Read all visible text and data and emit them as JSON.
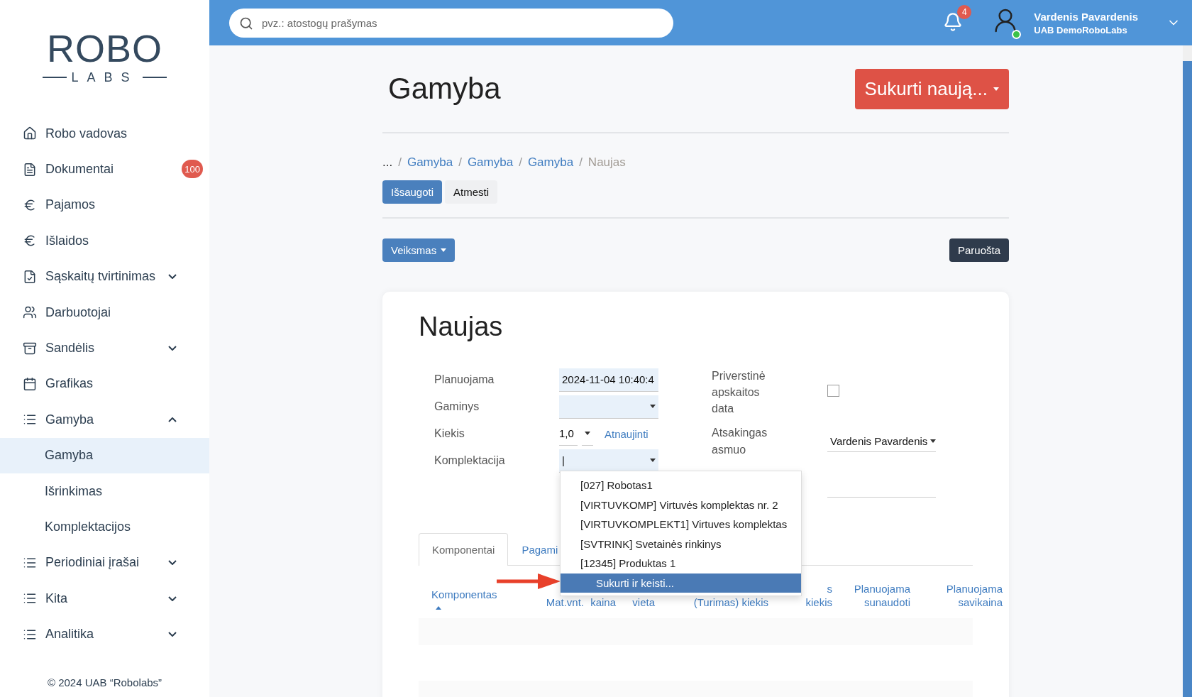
{
  "logo": {
    "top": "ROBO",
    "bottom": "LABS"
  },
  "sidebar": {
    "items": [
      {
        "label": "Robo vadovas",
        "selected": false
      },
      {
        "label": "Dokumentai",
        "badge": "100",
        "selected": false
      },
      {
        "label": "Pajamos",
        "selected": false
      },
      {
        "label": "Išlaidos",
        "selected": false
      },
      {
        "label": "Sąskaitų tvirtinimas",
        "expanded": false,
        "selected": false
      },
      {
        "label": "Darbuotojai",
        "selected": false
      },
      {
        "label": "Sandėlis",
        "expanded": false,
        "selected": false
      },
      {
        "label": "Grafikas",
        "selected": false
      },
      {
        "label": "Gamyba",
        "expanded": true,
        "selected": false,
        "children": [
          {
            "label": "Gamyba",
            "selected": true
          },
          {
            "label": "Išrinkimas",
            "selected": false
          },
          {
            "label": "Komplektacijos",
            "selected": false
          }
        ]
      },
      {
        "label": "Periodiniai įrašai",
        "expanded": false,
        "selected": false
      },
      {
        "label": "Kita",
        "expanded": false,
        "selected": false
      },
      {
        "label": "Analitika",
        "expanded": false,
        "selected": false
      }
    ],
    "footer": "© 2024 UAB “Robolabs”"
  },
  "topbar": {
    "search": {
      "placeholder": "pvz.: atostogų prašymas"
    },
    "notifications": "4",
    "user": {
      "name": "Vardenis Pavardenis",
      "company": "UAB DemoRoboLabs",
      "online": true
    }
  },
  "page": {
    "title": "Gamyba",
    "create_button": "Sukurti naują...",
    "breadcrumb": [
      {
        "label": "...",
        "link": false
      },
      {
        "separator": "/",
        "label": "Gamyba",
        "link": true
      },
      {
        "separator": "/",
        "label": "Gamyba",
        "link": true
      },
      {
        "separator": "/",
        "label": "Gamyba",
        "link": true
      },
      {
        "separator": "/",
        "label": "Naujas",
        "link": false
      }
    ],
    "save_button": "Išsaugoti",
    "discard_button": "Atmesti",
    "action_button": "Veiksmas",
    "status_button": "Paruošta"
  },
  "form": {
    "title": "Naujas",
    "left_fields": [
      {
        "label": "Planuojama",
        "kind": "text",
        "value": "2024-11-04 10:40:4"
      },
      {
        "label": "Gaminys",
        "kind": "select"
      },
      {
        "label": "Kiekis",
        "kind": "quantity",
        "value": "1,0",
        "link": "Atnaujinti"
      },
      {
        "label": "Komplektacija",
        "kind": "select",
        "value": "|"
      }
    ],
    "right_fields": [
      {
        "label": "Priverstinė apskaitos data",
        "kind": "checkbox",
        "checked": false
      },
      {
        "label": "Atsakingas asmuo",
        "kind": "select",
        "value": "Vardenis Pavardenis"
      },
      {
        "kind": "blank"
      }
    ],
    "dropdown": [
      {
        "label": "[027] Robotas1",
        "kind": "option",
        "selected": false
      },
      {
        "label": "[VIRTUVKOMP] Virtuvės komplektas nr. 2",
        "kind": "option",
        "selected": false
      },
      {
        "label": "[VIRTUVKOMPLEKT1] Virtuves komplektas",
        "kind": "option",
        "selected": false
      },
      {
        "label": "[SVTRINK] Svetainės rinkinys",
        "kind": "option",
        "selected": false
      },
      {
        "label": "[12345] Produktas 1",
        "kind": "option",
        "selected": false
      },
      {
        "label": "Sukurti ir keisti...",
        "kind": "action",
        "selected": true
      }
    ],
    "tabs": [
      {
        "label": "Komponentai",
        "selected": true
      },
      {
        "label": "Pagami",
        "selected": false
      }
    ],
    "table": {
      "columns": [
        {
          "lines": [
            "Komponentas"
          ],
          "sorted": true
        },
        {
          "lines": [
            "Mat.vnt."
          ],
          "sorted": false
        },
        {
          "lines": [
            "kaina"
          ],
          "sorted": false
        },
        {
          "lines": [
            "vieta"
          ],
          "sorted": false
        },
        {
          "lines": [
            "(Turimas) kiekis"
          ],
          "sorted": false
        },
        {
          "lines": [
            "s",
            "kiekis"
          ],
          "sorted": false
        },
        {
          "lines": [
            "Planuojama",
            "sunaudoti"
          ],
          "sorted": false
        },
        {
          "lines": [
            "Planuojama",
            "savikaina"
          ],
          "sorted": false
        }
      ]
    }
  }
}
